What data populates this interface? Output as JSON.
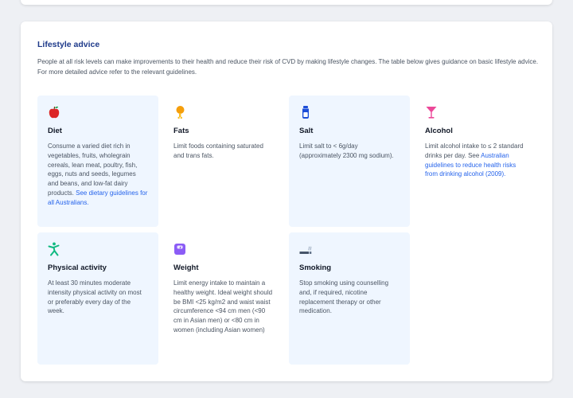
{
  "section": {
    "title": "Lifestyle advice",
    "intro": "People at all risk levels can make improvements to their health and reduce their risk of CVD by making lifestyle changes. The table below gives guidance on basic lifestyle advice. For more detailed advice refer to the relevant guidelines."
  },
  "tiles": [
    {
      "icon": "apple-icon",
      "title": "Diet",
      "body": "Consume a varied diet rich in vegetables, fruits, wholegrain cereals, lean meat, poultry, fish, eggs, nuts and seeds, legumes and beans, and low-fat dairy products.",
      "link": "See dietary guidelines for all Australians."
    },
    {
      "icon": "drumstick-icon",
      "title": "Fats",
      "body": "Limit foods containing saturated and trans fats."
    },
    {
      "icon": "salt-shaker-icon",
      "title": "Salt",
      "body": "Limit salt to < 6g/day (approximately 2300 mg sodium)."
    },
    {
      "icon": "cocktail-icon",
      "title": "Alcohol",
      "body": "Limit alcohol intake to ≤ 2 standard drinks per day. See",
      "link": "Australian guidelines to reduce health risks from drinking alcohol (2009)."
    },
    {
      "icon": "running-person-icon",
      "title": "Physical activity",
      "body": "At least 30 minutes moderate intensity physical activity on most or preferably every day of the week."
    },
    {
      "icon": "scale-icon",
      "title": "Weight",
      "body": "Limit energy intake to maintain a healthy weight. Ideal weight should be BMI <25 kg/m2 and waist waist circumference <94 cm men (<90 cm in Asian men) or <80 cm in women (including Asian women)"
    },
    {
      "icon": "cigarette-icon",
      "title": "Smoking",
      "body": "Stop smoking using counselling and, if required, nicotine replacement therapy or other medication."
    }
  ],
  "colors": {
    "title": "#1e3a8a",
    "link": "#2563eb",
    "tile_background": "#eff6ff",
    "diet_icon": "#dc2626",
    "fats_icon": "#f59e0b",
    "salt_icon": "#1d4ed8",
    "alcohol_icon": "#ec4899",
    "activity_icon": "#10b981",
    "weight_icon": "#8b5cf6",
    "smoking_icon": "#475569"
  }
}
